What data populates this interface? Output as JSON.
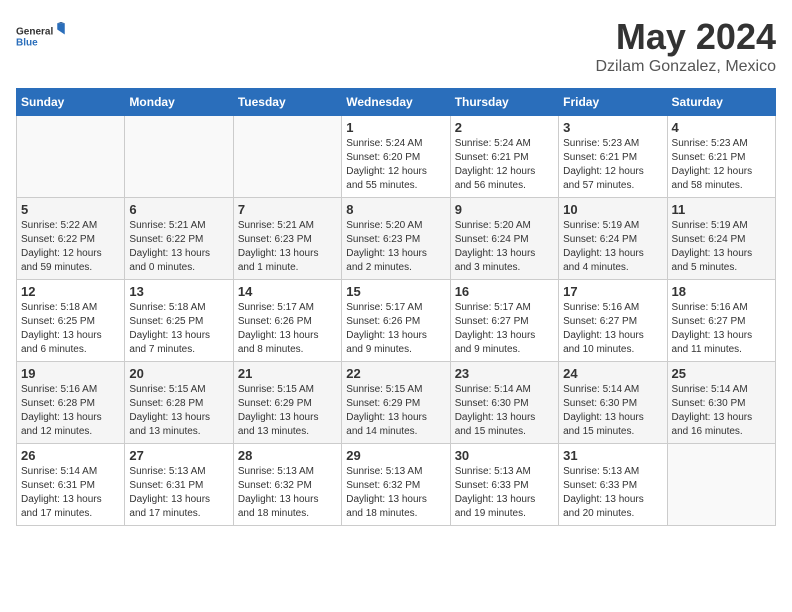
{
  "header": {
    "logo_general": "General",
    "logo_blue": "Blue",
    "month_year": "May 2024",
    "location": "Dzilam Gonzalez, Mexico"
  },
  "weekdays": [
    "Sunday",
    "Monday",
    "Tuesday",
    "Wednesday",
    "Thursday",
    "Friday",
    "Saturday"
  ],
  "weeks": [
    [
      {
        "day": "",
        "info": ""
      },
      {
        "day": "",
        "info": ""
      },
      {
        "day": "",
        "info": ""
      },
      {
        "day": "1",
        "info": "Sunrise: 5:24 AM\nSunset: 6:20 PM\nDaylight: 12 hours\nand 55 minutes."
      },
      {
        "day": "2",
        "info": "Sunrise: 5:24 AM\nSunset: 6:21 PM\nDaylight: 12 hours\nand 56 minutes."
      },
      {
        "day": "3",
        "info": "Sunrise: 5:23 AM\nSunset: 6:21 PM\nDaylight: 12 hours\nand 57 minutes."
      },
      {
        "day": "4",
        "info": "Sunrise: 5:23 AM\nSunset: 6:21 PM\nDaylight: 12 hours\nand 58 minutes."
      }
    ],
    [
      {
        "day": "5",
        "info": "Sunrise: 5:22 AM\nSunset: 6:22 PM\nDaylight: 12 hours\nand 59 minutes."
      },
      {
        "day": "6",
        "info": "Sunrise: 5:21 AM\nSunset: 6:22 PM\nDaylight: 13 hours\nand 0 minutes."
      },
      {
        "day": "7",
        "info": "Sunrise: 5:21 AM\nSunset: 6:23 PM\nDaylight: 13 hours\nand 1 minute."
      },
      {
        "day": "8",
        "info": "Sunrise: 5:20 AM\nSunset: 6:23 PM\nDaylight: 13 hours\nand 2 minutes."
      },
      {
        "day": "9",
        "info": "Sunrise: 5:20 AM\nSunset: 6:24 PM\nDaylight: 13 hours\nand 3 minutes."
      },
      {
        "day": "10",
        "info": "Sunrise: 5:19 AM\nSunset: 6:24 PM\nDaylight: 13 hours\nand 4 minutes."
      },
      {
        "day": "11",
        "info": "Sunrise: 5:19 AM\nSunset: 6:24 PM\nDaylight: 13 hours\nand 5 minutes."
      }
    ],
    [
      {
        "day": "12",
        "info": "Sunrise: 5:18 AM\nSunset: 6:25 PM\nDaylight: 13 hours\nand 6 minutes."
      },
      {
        "day": "13",
        "info": "Sunrise: 5:18 AM\nSunset: 6:25 PM\nDaylight: 13 hours\nand 7 minutes."
      },
      {
        "day": "14",
        "info": "Sunrise: 5:17 AM\nSunset: 6:26 PM\nDaylight: 13 hours\nand 8 minutes."
      },
      {
        "day": "15",
        "info": "Sunrise: 5:17 AM\nSunset: 6:26 PM\nDaylight: 13 hours\nand 9 minutes."
      },
      {
        "day": "16",
        "info": "Sunrise: 5:17 AM\nSunset: 6:27 PM\nDaylight: 13 hours\nand 9 minutes."
      },
      {
        "day": "17",
        "info": "Sunrise: 5:16 AM\nSunset: 6:27 PM\nDaylight: 13 hours\nand 10 minutes."
      },
      {
        "day": "18",
        "info": "Sunrise: 5:16 AM\nSunset: 6:27 PM\nDaylight: 13 hours\nand 11 minutes."
      }
    ],
    [
      {
        "day": "19",
        "info": "Sunrise: 5:16 AM\nSunset: 6:28 PM\nDaylight: 13 hours\nand 12 minutes."
      },
      {
        "day": "20",
        "info": "Sunrise: 5:15 AM\nSunset: 6:28 PM\nDaylight: 13 hours\nand 13 minutes."
      },
      {
        "day": "21",
        "info": "Sunrise: 5:15 AM\nSunset: 6:29 PM\nDaylight: 13 hours\nand 13 minutes."
      },
      {
        "day": "22",
        "info": "Sunrise: 5:15 AM\nSunset: 6:29 PM\nDaylight: 13 hours\nand 14 minutes."
      },
      {
        "day": "23",
        "info": "Sunrise: 5:14 AM\nSunset: 6:30 PM\nDaylight: 13 hours\nand 15 minutes."
      },
      {
        "day": "24",
        "info": "Sunrise: 5:14 AM\nSunset: 6:30 PM\nDaylight: 13 hours\nand 15 minutes."
      },
      {
        "day": "25",
        "info": "Sunrise: 5:14 AM\nSunset: 6:30 PM\nDaylight: 13 hours\nand 16 minutes."
      }
    ],
    [
      {
        "day": "26",
        "info": "Sunrise: 5:14 AM\nSunset: 6:31 PM\nDaylight: 13 hours\nand 17 minutes."
      },
      {
        "day": "27",
        "info": "Sunrise: 5:13 AM\nSunset: 6:31 PM\nDaylight: 13 hours\nand 17 minutes."
      },
      {
        "day": "28",
        "info": "Sunrise: 5:13 AM\nSunset: 6:32 PM\nDaylight: 13 hours\nand 18 minutes."
      },
      {
        "day": "29",
        "info": "Sunrise: 5:13 AM\nSunset: 6:32 PM\nDaylight: 13 hours\nand 18 minutes."
      },
      {
        "day": "30",
        "info": "Sunrise: 5:13 AM\nSunset: 6:33 PM\nDaylight: 13 hours\nand 19 minutes."
      },
      {
        "day": "31",
        "info": "Sunrise: 5:13 AM\nSunset: 6:33 PM\nDaylight: 13 hours\nand 20 minutes."
      },
      {
        "day": "",
        "info": ""
      }
    ]
  ]
}
